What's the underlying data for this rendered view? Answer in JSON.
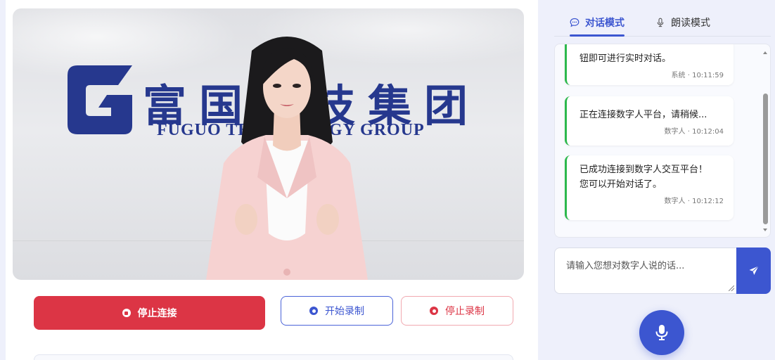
{
  "video": {
    "brand_cn": "富国科技集团",
    "brand_en": "FUGUO TECHNOLOGY GROUP"
  },
  "controls": {
    "stop_connection": "停止连接",
    "start_recording": "开始录制",
    "stop_recording": "停止录制"
  },
  "tabs": [
    {
      "label": "对话模式",
      "icon": "chat-bubble-icon",
      "active": true
    },
    {
      "label": "朗读模式",
      "icon": "microphone-icon",
      "active": false
    }
  ],
  "messages": [
    {
      "text": "钮即可进行实时对话。",
      "sender": "系统",
      "time": "10:11:59",
      "meta": "系统 · 10:11:59"
    },
    {
      "text": "正在连接数字人平台，请稍候...",
      "sender": "数字人",
      "time": "10:12:04",
      "meta": "数字人 · 10:12:04"
    },
    {
      "text": "已成功连接到数字人交互平台！您可以开始对话了。",
      "sender": "数字人",
      "time": "10:12:12",
      "meta": "数字人 · 10:12:12"
    }
  ],
  "input": {
    "placeholder": "请输入您想对数字人说的话..."
  },
  "colors": {
    "primary": "#3c56d0",
    "danger": "#dc3545",
    "message_border": "#2db84d",
    "brand_blue": "#26388e"
  }
}
